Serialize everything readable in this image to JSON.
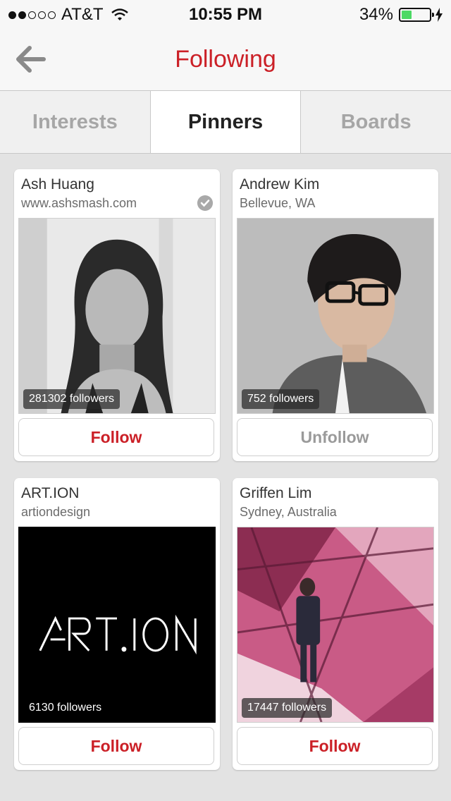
{
  "status": {
    "carrier": "AT&T",
    "time": "10:55 PM",
    "battery": "34%",
    "battery_level": 0.34
  },
  "nav": {
    "title": "Following",
    "title_color": "#cb2027"
  },
  "tabs": [
    {
      "label": "Interests",
      "active": false
    },
    {
      "label": "Pinners",
      "active": true
    },
    {
      "label": "Boards",
      "active": false
    }
  ],
  "cards": [
    {
      "name": "Ash Huang",
      "subtitle": "www.ashsmash.com",
      "verified": true,
      "followers": "281302 followers",
      "button": "Follow"
    },
    {
      "name": "Andrew Kim",
      "subtitle": "Bellevue, WA",
      "verified": false,
      "followers": "752 followers",
      "button": "Unfollow"
    },
    {
      "name": "ART.ION",
      "subtitle": "artiondesign",
      "verified": false,
      "followers": "6130 followers",
      "button": "Follow",
      "logo_text": "ART.ION"
    },
    {
      "name": "Griffen Lim",
      "subtitle": "Sydney, Australia",
      "verified": false,
      "followers": "17447 followers",
      "button": "Follow"
    }
  ]
}
